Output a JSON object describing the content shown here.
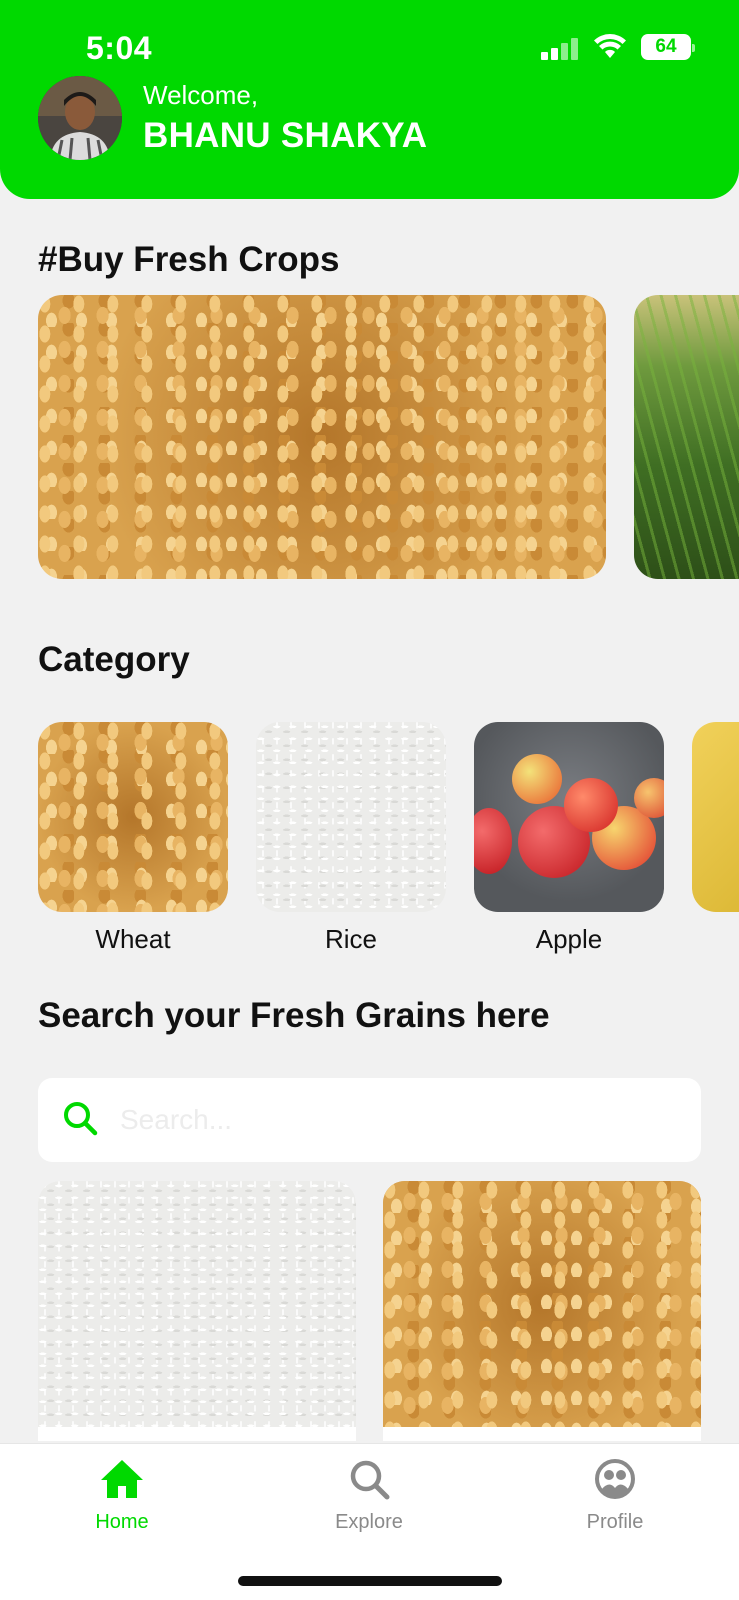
{
  "status_bar": {
    "time": "5:04",
    "battery": "64"
  },
  "header": {
    "welcome": "Welcome,",
    "user_name": "BHANU SHAKYA"
  },
  "sections": {
    "buy_fresh_title": "#Buy Fresh Crops",
    "category_title": "Category",
    "search_title": "Search your Fresh Grains here"
  },
  "banners": [
    {
      "name": "wheat-banner"
    },
    {
      "name": "field-banner"
    }
  ],
  "categories": [
    {
      "label": "Wheat"
    },
    {
      "label": "Rice"
    },
    {
      "label": "Apple"
    }
  ],
  "search": {
    "placeholder": "Search...",
    "value": ""
  },
  "nav": {
    "home": "Home",
    "explore": "Explore",
    "profile": "Profile",
    "active": "Home"
  },
  "colors": {
    "accent": "#00d900",
    "background": "#f1f1f1"
  },
  "icons": [
    "signal-icon",
    "wifi-icon",
    "battery-icon",
    "search-icon",
    "home-icon",
    "explore-icon",
    "profile-icon"
  ]
}
